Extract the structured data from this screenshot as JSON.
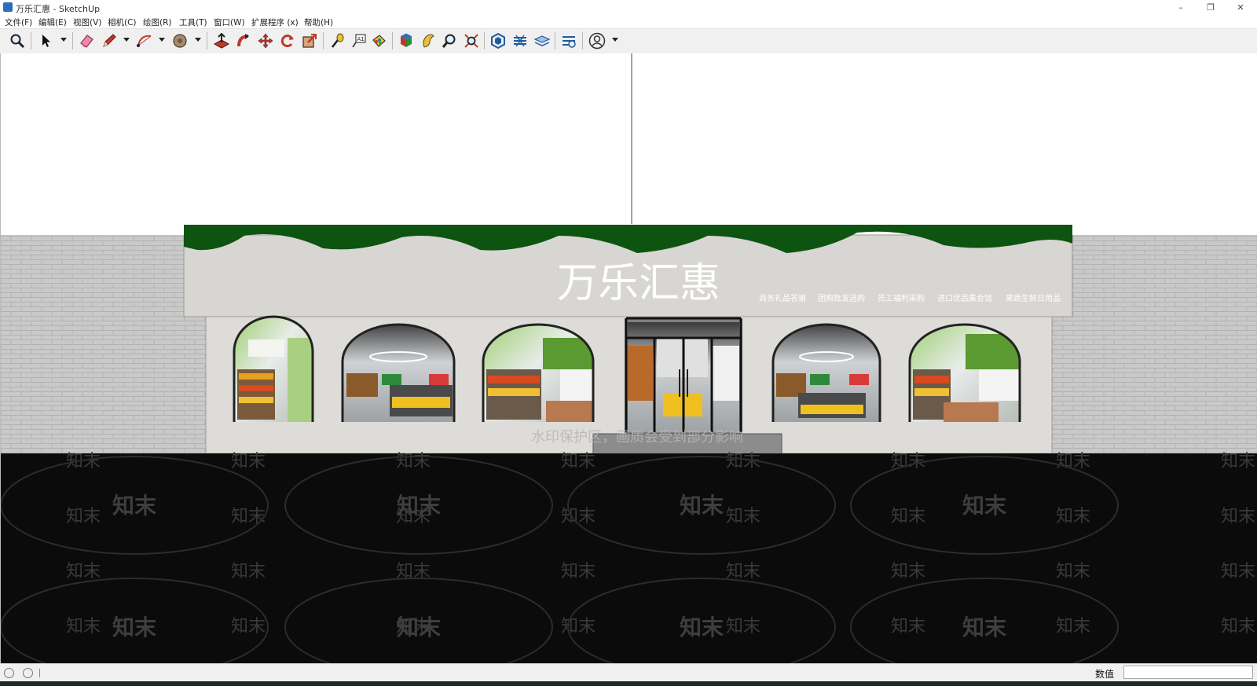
{
  "window": {
    "title": "万乐汇惠 - SketchUp",
    "controls": [
      "minimize-icon",
      "restore-icon",
      "close-icon"
    ]
  },
  "menu": [
    "文件(F)",
    "编辑(E)",
    "视图(V)",
    "相机(C)",
    "绘图(R)",
    "工具(T)",
    "窗口(W)",
    "扩展程序 (x)",
    "帮助(H)"
  ],
  "toolbar": {
    "tools": [
      "zoom-icon",
      "select-icon",
      "eraser-icon",
      "pencil-icon",
      "arc-icon",
      "shape-icon",
      "push-pull-icon",
      "follow-me-icon",
      "move-icon",
      "rotate-icon",
      "scale-icon",
      "tape-measure-icon",
      "text-icon",
      "paint-bucket-icon",
      "section-plane-icon",
      "orbit-icon",
      "zoom-icon",
      "zoom-extents-icon",
      "3d-warehouse-icon",
      "extension-warehouse-icon",
      "layout-icon",
      "extension-manager-icon",
      "account-icon"
    ]
  },
  "scene": {
    "store_name": "万乐汇惠",
    "taglines": [
      "商务礼品答谢",
      "团购批发选购",
      "员工福利采购",
      "进口优品集合馆",
      "果蔬生鲜日用品"
    ],
    "watermark_brand": "知末",
    "watermark_notice": "水印保护区，画质会受到部分影响",
    "colors": {
      "canopy_green": "#0d5410",
      "facade_gray": "#dcdad6",
      "brick_wall": "#c9c9c9",
      "ground_dark": "#0b0b0b"
    }
  },
  "status": {
    "value_label": "数值",
    "value_text": ""
  }
}
